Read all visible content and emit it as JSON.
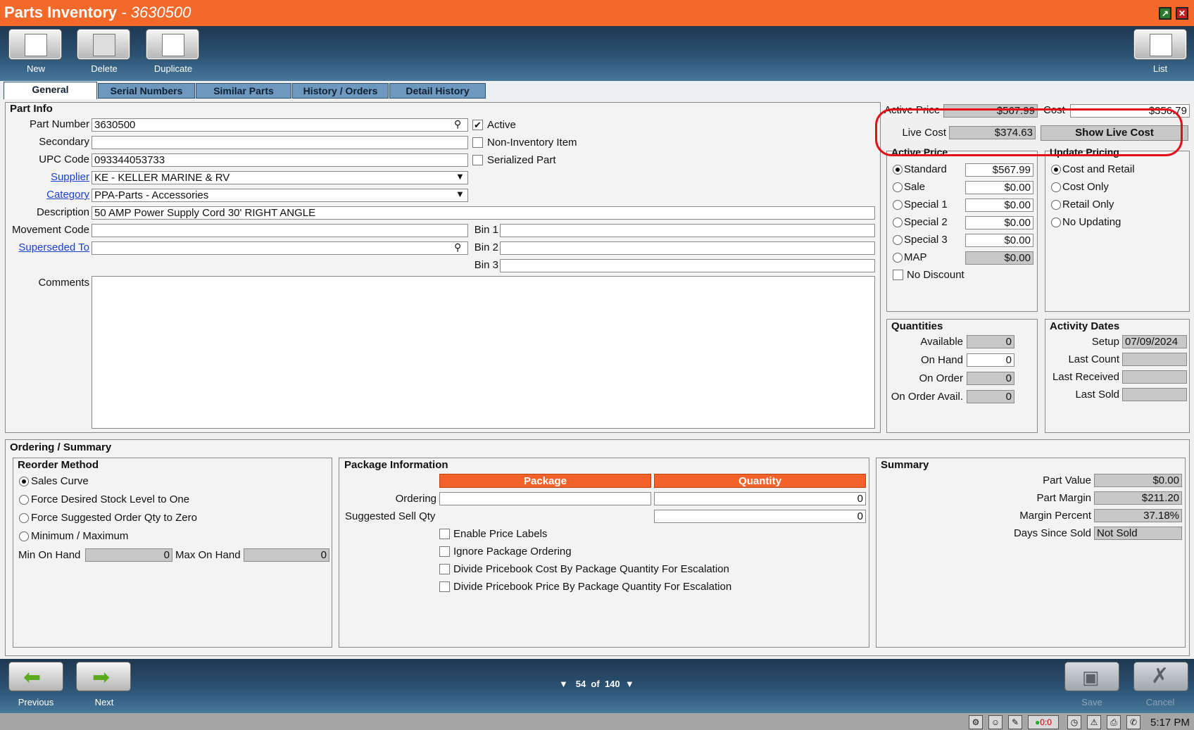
{
  "window": {
    "title": "Parts Inventory",
    "title_part": "- 3630500"
  },
  "toolbar": {
    "new": "New",
    "delete": "Delete",
    "duplicate": "Duplicate",
    "list": "List"
  },
  "tabs": [
    "General",
    "Serial Numbers",
    "Similar Parts",
    "History / Orders",
    "Detail History"
  ],
  "part_info": {
    "title": "Part Info",
    "part_number_label": "Part Number",
    "part_number": "3630500",
    "secondary_label": "Secondary",
    "secondary": "",
    "upc_label": "UPC Code",
    "upc": "093344053733",
    "supplier_label": "Supplier",
    "supplier": "KE - KELLER MARINE & RV",
    "category_label": "Category",
    "category": "PPA-Parts - Accessories",
    "description_label": "Description",
    "description": "50 AMP Power Supply Cord 30' RIGHT ANGLE",
    "movement_label": "Movement Code",
    "movement": "",
    "superseded_label": "Superseded To",
    "superseded": "",
    "comments_label": "Comments",
    "comments": "",
    "active_label": "Active",
    "noninv_label": "Non-Inventory Item",
    "serialized_label": "Serialized Part",
    "bin1_label": "Bin 1",
    "bin2_label": "Bin 2",
    "bin3_label": "Bin 3",
    "check_mark": "✔"
  },
  "pricing": {
    "active_price_label": "Active Price",
    "active_price": "$567.99",
    "cost_label": "Cost",
    "cost": "$356.79",
    "live_cost_label": "Live Cost",
    "live_cost": "$374.63",
    "show_live_cost": "Show Live Cost",
    "active_price_group": "Active Price",
    "prices": [
      {
        "label": "Standard",
        "value": "$567.99",
        "selected": true
      },
      {
        "label": "Sale",
        "value": "$0.00"
      },
      {
        "label": "Special 1",
        "value": "$0.00"
      },
      {
        "label": "Special 2",
        "value": "$0.00"
      },
      {
        "label": "Special 3",
        "value": "$0.00"
      },
      {
        "label": "MAP",
        "value": "$0.00"
      }
    ],
    "no_discount": "No Discount",
    "update_group": "Update Pricing",
    "update_options": [
      "Cost and Retail",
      "Cost Only",
      "Retail Only",
      "No Updating"
    ]
  },
  "quantities": {
    "title": "Quantities",
    "available_label": "Available",
    "available": "0",
    "onhand_label": "On Hand",
    "onhand": "0",
    "onorder_label": "On Order",
    "onorder": "0",
    "onorderavail_label": "On Order Avail.",
    "onorderavail": "0"
  },
  "activity": {
    "title": "Activity Dates",
    "setup_label": "Setup",
    "setup": "07/09/2024",
    "lastcount_label": "Last Count",
    "lastreceived_label": "Last Received",
    "lastsold_label": "Last Sold"
  },
  "ordering": {
    "title": "Ordering / Summary",
    "reorder_title": "Reorder Method",
    "methods": [
      "Sales Curve",
      "Force Desired Stock Level to One",
      "Force Suggested Order Qty to Zero",
      "Minimum / Maximum"
    ],
    "min_label": "Min On Hand",
    "min": "0",
    "max_label": "Max On Hand",
    "max": "0",
    "package_title": "Package Information",
    "package_hdr": "Package",
    "quantity_hdr": "Quantity",
    "ordering_label": "Ordering",
    "ordering_qty": "0",
    "suggested_label": "Suggested Sell Qty",
    "suggested_qty": "0",
    "options": [
      "Enable Price Labels",
      "Ignore Package Ordering",
      "Divide Pricebook Cost By Package Quantity For Escalation",
      "Divide Pricebook Price By Package Quantity For Escalation"
    ]
  },
  "summary": {
    "title": "Summary",
    "part_value_label": "Part Value",
    "part_value": "$0.00",
    "margin_label": "Part Margin",
    "margin": "$211.20",
    "margin_pct_label": "Margin Percent",
    "margin_pct": "37.18%",
    "days_label": "Days Since Sold",
    "days": "Not Sold"
  },
  "footer": {
    "previous": "Previous",
    "next": "Next",
    "record": "54",
    "of": "of",
    "total": "140",
    "save": "Save",
    "cancel": "Cancel"
  },
  "status": {
    "clock": "5:17 PM",
    "counter": "0:0"
  },
  "colors": {
    "titlebar": "#f4692a",
    "toolbar": "#2c5374",
    "header_orange": "#f3622a",
    "annotation": "#e3101a"
  }
}
